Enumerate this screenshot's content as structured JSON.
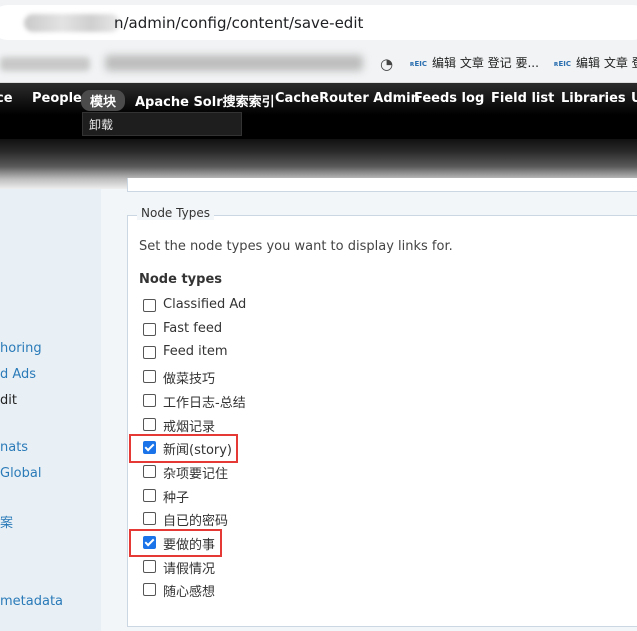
{
  "browser": {
    "url": "n/admin/config/content/save-edit",
    "bookmarks": [
      {
        "icon_text": "ʀEIC",
        "label": "编辑 文章 登记 要..."
      },
      {
        "icon_text": "ʀEIC",
        "label": "编辑 文章 登记"
      }
    ]
  },
  "toolbar": {
    "items": [
      "ce",
      "People",
      "模块",
      "Apache Solr搜索索引",
      "CacheRouter Admin",
      "Feeds log",
      "Field list",
      "Libraries",
      "U"
    ],
    "submenu": "卸载"
  },
  "sidebar": {
    "links": [
      "horing",
      "d Ads",
      "dit",
      "nats",
      "Global",
      "案",
      "metadata"
    ]
  },
  "fieldset": {
    "legend": "Node Types",
    "description": "Set the node types you want to display links for.",
    "group_title": "Node types",
    "options": [
      {
        "label": "Classified Ad",
        "checked": false
      },
      {
        "label": "Fast feed",
        "checked": false
      },
      {
        "label": "Feed item",
        "checked": false
      },
      {
        "label": "做菜技巧",
        "checked": false
      },
      {
        "label": "工作日志-总结",
        "checked": false
      },
      {
        "label": "戒烟记录",
        "checked": false
      },
      {
        "label": "新闻(story)",
        "checked": true
      },
      {
        "label": "杂项要记住",
        "checked": false
      },
      {
        "label": "种子",
        "checked": false
      },
      {
        "label": "自已的密码",
        "checked": false
      },
      {
        "label": "要做的事",
        "checked": true
      },
      {
        "label": "请假情况",
        "checked": false
      },
      {
        "label": "随心感想",
        "checked": false
      }
    ]
  },
  "colors": {
    "highlight": "#e53935",
    "link": "#2a7ab8",
    "checkbox_checked": "#1a73e8"
  }
}
